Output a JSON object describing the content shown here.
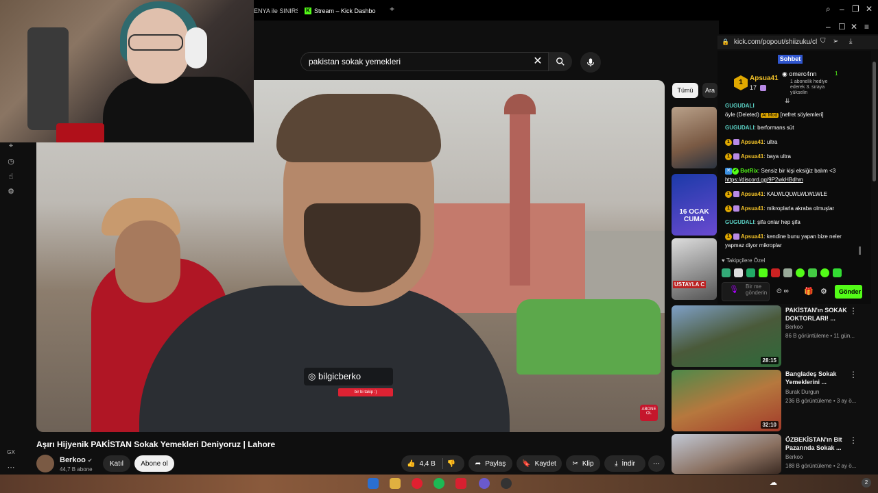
{
  "browser": {
    "tabs": [
      {
        "label": "ENYA ile SINIRS",
        "active": false
      },
      {
        "label": "Stream – Kick Dashbo",
        "active": true
      }
    ],
    "new_tab_glyph": "+",
    "popup_url": "kick.com/popout/shiizuku/cl"
  },
  "youtube": {
    "search": {
      "value": "pakistan sokak yemekleri"
    },
    "filters": [
      "Tümü",
      "Ara"
    ],
    "video": {
      "title": "Aşırı Hijyenik PAKİSTAN Sokak Yemekleri Deniyoruz | Lahore",
      "watermark_handle": "bilgicberko",
      "watermark_sub": "bir bi takip :)",
      "abone_logo": "ABONE OL"
    },
    "channel": {
      "name": "Berkoo",
      "subs": "44,7 B abone"
    },
    "actions": {
      "join": "Katıl",
      "subscribe": "Abone ol",
      "likes": "4,4 B",
      "share": "Paylaş",
      "save": "Kaydet",
      "clip": "Klip",
      "download": "İndir"
    },
    "recommended": [
      {
        "title": "PAKİSTAN'ın SOKAK DOKTORLARI! ...",
        "channel": "Berkoo",
        "meta": "86 B görüntüleme • 11 gün...",
        "duration": "28:15"
      },
      {
        "title": "Bangladeş Sokak Yemeklerini ...",
        "channel": "Burak Durgun",
        "meta": "236 B görüntüleme • 3 ay ö...",
        "duration": "32:10"
      },
      {
        "title": "ÖZBEKİSTAN'ın Bit Pazarında Sokak ...",
        "channel": "Berkoo",
        "meta": "188 B görüntüleme • 2 ay ö..."
      }
    ],
    "thumb_overlay": {
      "date": "16 OCAK CUMA",
      "store": "USTAYLA C"
    },
    "leftnav_label": "GX"
  },
  "kick_chat": {
    "tab_label": "Sohbet",
    "pinned": {
      "left_user": "Apsua41",
      "left_count": "17",
      "right_user": "omerc4nn",
      "right_count": "1",
      "right_desc": "1 abonelik hediye ederek 3. sıraya yükselin"
    },
    "messages": [
      {
        "user": "GUGUDALI",
        "prefix": "öyle (Deleted)",
        "badge": "AI Mod",
        "text": "[nefret söylemleri]"
      },
      {
        "user": "GUGUDALI",
        "text": "berformans süt"
      },
      {
        "user": "Apsua41",
        "text": "ultra"
      },
      {
        "user": "Apsua41",
        "text": "baya ultra"
      },
      {
        "user": "BotRix",
        "text": "Sensiz bir kişi eksiğiz balım <3",
        "link": "https://discord.gg/9P2wkHBdhm"
      },
      {
        "user": "Apsua41",
        "text": "KALWLQLWLWLWLWLE"
      },
      {
        "user": "Apsua41",
        "text": "mikroplarla akraba olmuşlar"
      },
      {
        "user": "GUGUDALI",
        "text": "şifa onlar hep şifa"
      },
      {
        "user": "Apsua41",
        "text": "kendine bunu yapan bize neler yapmaz diyor mikroplar"
      }
    ],
    "followers_only": "Takipçilere Özel",
    "input_placeholder": "Bir me gönderin",
    "send_label": "Gönder",
    "slow_mode_label": "∞"
  },
  "colors": {
    "kick_green": "#53fc18",
    "sub_gold": "#e0a800",
    "chat_tab_blue": "#3056ce"
  }
}
